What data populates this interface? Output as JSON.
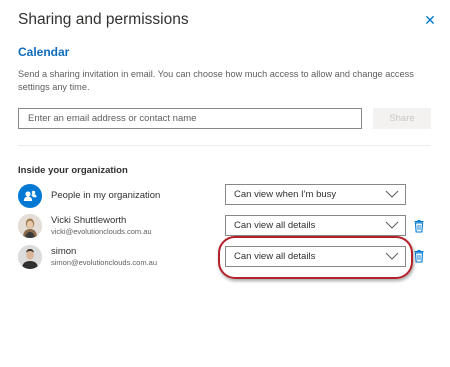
{
  "dialog": {
    "title": "Sharing and permissions",
    "close_label": "✕"
  },
  "calendar": {
    "title": "Calendar",
    "description": "Send a sharing invitation in email. You can choose how much access to allow and change access settings any time."
  },
  "invite": {
    "placeholder": "Enter an email address or contact name",
    "value": "",
    "share_label": "Share"
  },
  "organization": {
    "heading": "Inside your organization",
    "entries": [
      {
        "name": "People in my organization",
        "email": "",
        "permission": "Can view when I'm busy",
        "avatar_icon": "people-icon"
      },
      {
        "name": "Vicki Shuttleworth",
        "email": "vicki@evolutionclouds.com.au",
        "permission": "Can view all details",
        "avatar_icon": "avatar-photo"
      },
      {
        "name": "simon",
        "email": "simon@evolutionclouds.com.au",
        "permission": "Can view all details",
        "avatar_icon": "avatar-photo"
      }
    ]
  },
  "colors": {
    "accent": "#0078d4",
    "highlight_ring": "#b3202a",
    "title_text": "#323130"
  }
}
